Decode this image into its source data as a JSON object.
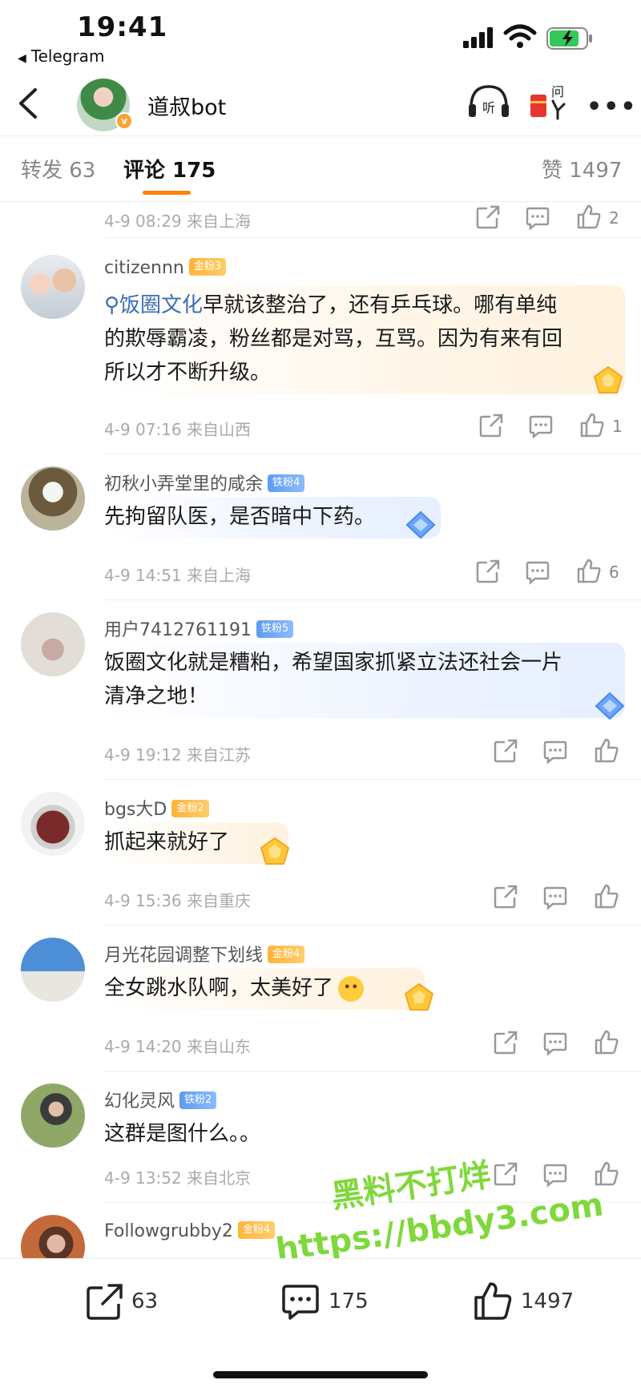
{
  "status_bar": {
    "time": "19:41",
    "back_app": "Telegram"
  },
  "header": {
    "title": "道叔bot"
  },
  "tabs": {
    "repost": "转发 63",
    "comments": "评论 175",
    "likes": "赞 1497"
  },
  "top_meta": {
    "time_loc": "4-9 08:29 来自上海",
    "likes": "2"
  },
  "comments": [
    {
      "name": "citizennn",
      "badge": "金粉3",
      "hashtag": "饭圈文化",
      "text_line1": "早就该整治了，还有乒乓球。哪有单纯",
      "text_line2": "的欺辱霸凌，粉丝都是对骂，互骂。因为有来有回",
      "text_line3": "所以才不断升级。",
      "time_loc": "4-9 07:16 来自山西",
      "likes": "1"
    },
    {
      "name": "初秋小弄堂里的咸余",
      "badge": "铁粉4",
      "text_line1": "先拘留队医，是否暗中下药。",
      "time_loc": "4-9 14:51 来自上海",
      "likes": "6"
    },
    {
      "name": "用户7412761191",
      "badge": "铁粉5",
      "text_line1": "饭圈文化就是糟粕，希望国家抓紧立法还社会一片",
      "text_line2": "清净之地！",
      "time_loc": "4-9 19:12 来自江苏",
      "likes": ""
    },
    {
      "name": "bgs大D",
      "badge": "金粉2",
      "text_line1": "抓起来就好了",
      "time_loc": "4-9 15:36 来自重庆",
      "likes": ""
    },
    {
      "name": "月光花园调整下划线",
      "badge": "金粉4",
      "text_line1": "全女跳水队啊，太美好了",
      "time_loc": "4-9 14:20 来自山东",
      "likes": ""
    },
    {
      "name": "幻化灵风",
      "badge": "铁粉2",
      "text_line1": "这群是图什么。。",
      "time_loc": "4-9 13:52 来自北京",
      "likes": ""
    },
    {
      "name": "Followgrubby2",
      "badge": "金粉4"
    }
  ],
  "watermark": {
    "line1": "黑料不打烊",
    "line2": "https://bbdy3.com"
  },
  "bottom_bar": {
    "repost_count": "63",
    "comment_count": "175",
    "like_count": "1497"
  }
}
